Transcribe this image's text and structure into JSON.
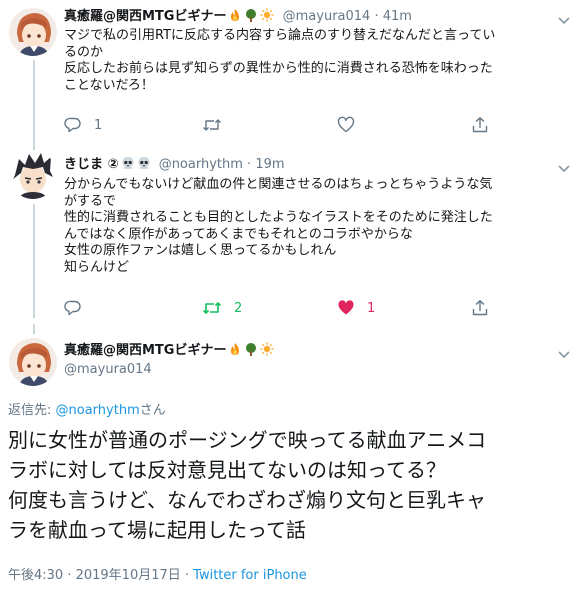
{
  "tweets": [
    {
      "author_name": "真癒羅@関西MTGビギナー",
      "author_handle": "@mayura014",
      "dot": "·",
      "time": "41m",
      "lines": [
        "マジで私の引用RTに反応する内容すら論点のすり替えだなんだと言ってい",
        "るのか",
        "反応したお前らは見ず知らずの異性から性的に消費される恐怖を味わった",
        "ことないだろ！"
      ],
      "reply_count": "1",
      "retweet_count": "",
      "like_count": ""
    },
    {
      "author_name": "きじま ②",
      "author_handle": "@noarhythm",
      "dot": "·",
      "time": "19m",
      "lines": [
        "分からんでもないけど献血の件と関連させるのはちょっとちゃうような気",
        "がするで",
        "性的に消費されることも目的としたようなイラストをそのために発注した",
        "んではなく原作があってあくまでもそれとのコラボやからな",
        "女性の原作ファンは嬉しく思ってるかもしれん",
        "知らんけど"
      ],
      "reply_count": "",
      "retweet_count": "2",
      "like_count": "1"
    }
  ],
  "main_tweet": {
    "author_name": "真癒羅@関西MTGビギナー",
    "author_handle": "@mayura014",
    "reply_label": "返信先: ",
    "reply_mention": "@noarhythm",
    "reply_suffix": "さん",
    "lines": [
      "別に女性が普通のポージングで映ってる献血アニメコ",
      "ラボに対しては反対意見出てないのは知ってる？",
      "何度も言うけど、なんでわざわざ煽り文句と巨乳キャ",
      "ラを献血って場に起用したって話"
    ],
    "timestamp": "午後4:30 · 2019年10月17日 · ",
    "source": "Twitter for iPhone"
  },
  "icons": {
    "author1_emojis": [
      "fire-icon",
      "tree-icon",
      "sun-icon"
    ],
    "author2_emojis": [
      "skull-icon",
      "skull-icon"
    ],
    "actions": [
      "reply-icon",
      "retweet-icon",
      "like-icon",
      "share-icon"
    ]
  },
  "colors": {
    "accent": "#1b95e0",
    "retweet": "#17bf63",
    "like": "#e0245e",
    "muted": "#657786",
    "line": "#ccd6dd"
  }
}
